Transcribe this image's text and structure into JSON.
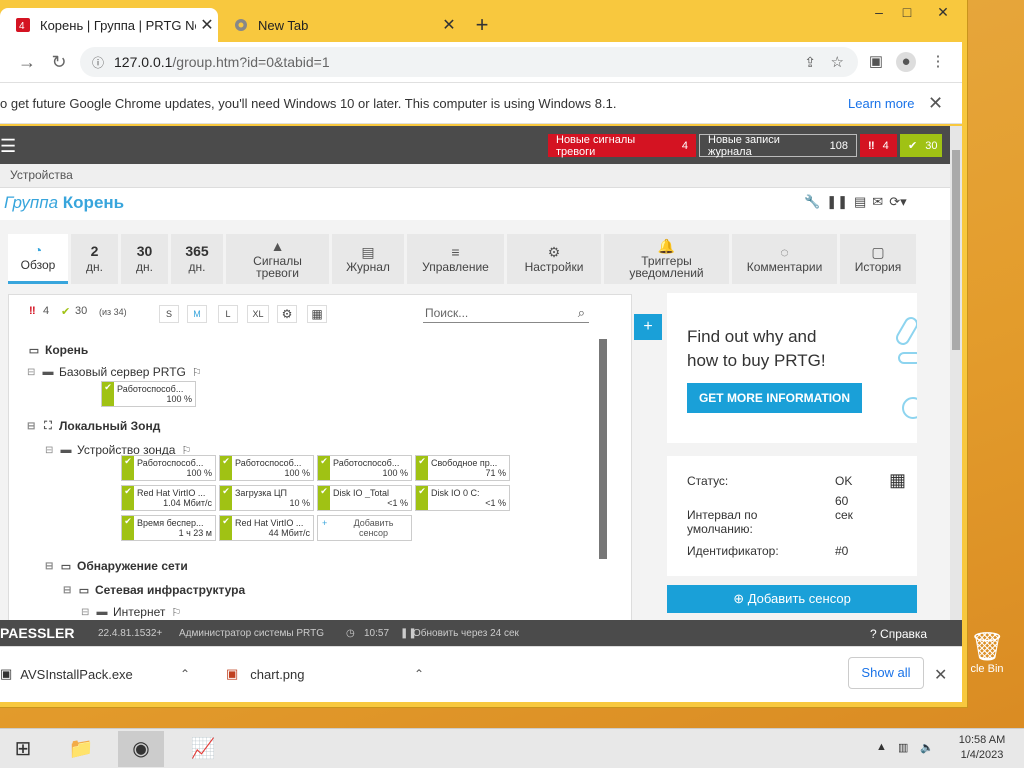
{
  "browser": {
    "tabs": [
      {
        "title": "Корень | Группа | PRTG Network",
        "close": "✕"
      },
      {
        "title": "New Tab",
        "close": "✕"
      }
    ],
    "new_tab": "+",
    "window_controls": {
      "minimize": "–",
      "maximize": "□",
      "close": "✕"
    },
    "url_host": "127.0.0.1",
    "url_path": "/group.htm?id=0&tabid=1",
    "infobar": {
      "message": "o get future Google Chrome updates, you'll need Windows 10 or later. This computer is using Windows 8.1.",
      "learn_more": "Learn more",
      "close": "✕"
    }
  },
  "prtg": {
    "header": {
      "new_alarms_label": "Новые сигналы тревоги",
      "new_alarms_count": "4",
      "new_log_label": "Новые записи журнала",
      "new_log_count": "108",
      "down_count": "4",
      "up_count": "30"
    },
    "breadcrumb": "Устройства",
    "title_prefix": "Группа",
    "title_name": "Корень",
    "tabs": [
      {
        "big": "",
        "label": "Обзор"
      },
      {
        "big": "2",
        "label": "дн."
      },
      {
        "big": "30",
        "label": "дн."
      },
      {
        "big": "365",
        "label": "дн."
      },
      {
        "big": "",
        "label": "Сигналы тревоги"
      },
      {
        "big": "",
        "label": "Журнал"
      },
      {
        "big": "",
        "label": "Управление"
      },
      {
        "big": "",
        "label": "Настройки"
      },
      {
        "big": "",
        "label": "Триггеры уведомлений"
      },
      {
        "big": "",
        "label": "Комментарии"
      },
      {
        "big": "",
        "label": "История"
      }
    ],
    "tree_toolbar": {
      "down": "4",
      "up": "30",
      "total": "(из 34)",
      "sizes": [
        "S",
        "M",
        "L",
        "XL"
      ],
      "search_placeholder": "Поиск..."
    },
    "tree": {
      "root": "Корень",
      "probe_server": "Базовый сервер PRTG",
      "probe_server_sensor": {
        "name": "Работоспособ...",
        "value": "100 %"
      },
      "local_probe": "Локальный Зонд",
      "probe_device": "Устройство зонда",
      "sensors": [
        {
          "name": "Работоспособ...",
          "value": "100 %"
        },
        {
          "name": "Работоспособ...",
          "value": "100 %"
        },
        {
          "name": "Работоспособ...",
          "value": "100 %"
        },
        {
          "name": "Свободное пр...",
          "value": "71 %"
        },
        {
          "name": "Red Hat VirtIO ...",
          "value": "1.04 Мбит/с"
        },
        {
          "name": "Загрузка ЦП",
          "value": "10 %"
        },
        {
          "name": "Disk IO _Total",
          "value": "<1 %"
        },
        {
          "name": "Disk IO 0 C:",
          "value": "<1 %"
        },
        {
          "name": "Время беспер...",
          "value": "1 ч 23 м"
        },
        {
          "name": "Red Hat VirtIO ...",
          "value": "44 Мбит/с"
        }
      ],
      "add_sensor": "Добавить сенсор",
      "discovery": "Обнаружение сети",
      "network": "Сетевая инфраструктура",
      "internet": "Интернет"
    },
    "promo": {
      "headline": "Find out why and how to buy PRTG!",
      "button": "GET MORE INFORMATION"
    },
    "status": {
      "status_label": "Статус:",
      "status_value": "OK",
      "interval_label": "Интервал по умолчанию:",
      "interval_value": "60 сек",
      "id_label": "Идентификатор:",
      "id_value": "#0"
    },
    "add_sensor_button": "Добавить сенсор",
    "footer": {
      "logo": "PAESSLER",
      "version": "22.4.81.1532+",
      "user": "Администратор системы PRTG",
      "time": "10:57",
      "refresh": "Обновить через 24 сек",
      "help": "Справка"
    }
  },
  "downloads": [
    {
      "name": "AVSInstallPack.exe"
    },
    {
      "name": "chart.png"
    }
  ],
  "downloads_show_all": "Show all",
  "desktop": {
    "recycle_bin": "cle Bin"
  },
  "clock": {
    "time": "10:58 AM",
    "date": "1/4/2023"
  }
}
